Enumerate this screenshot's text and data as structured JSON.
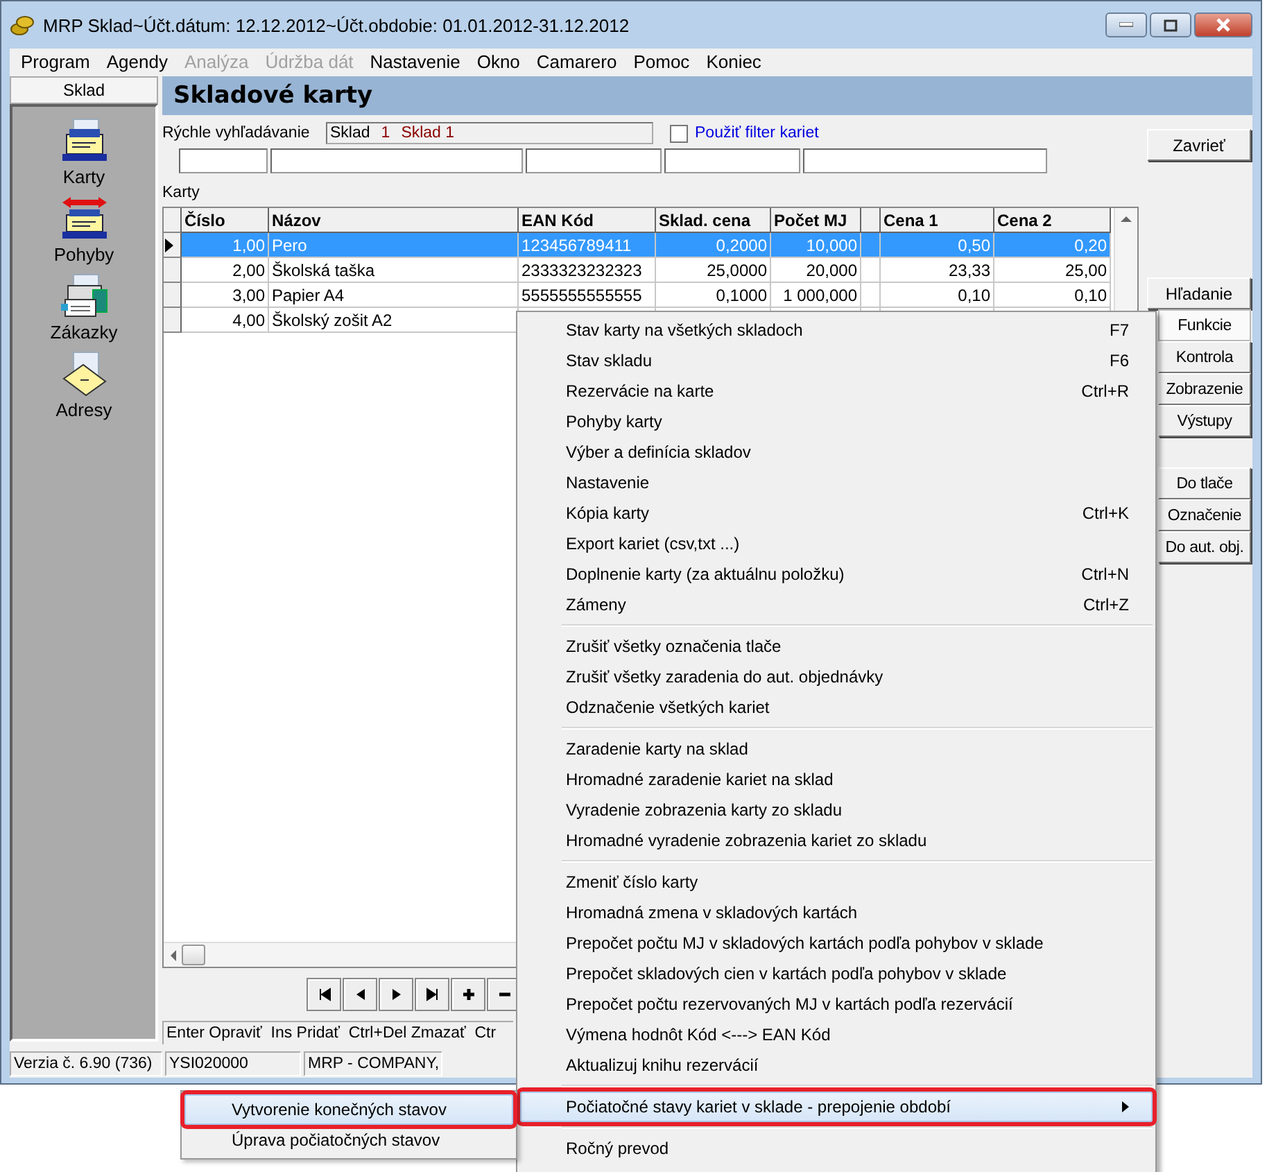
{
  "window": {
    "title": "MRP Sklad~Účt.dátum: 12.12.2012~Účt.obdobie: 01.01.2012-31.12.2012"
  },
  "menu_bar": [
    {
      "label": "Program",
      "disabled": false
    },
    {
      "label": "Agendy",
      "disabled": false
    },
    {
      "label": "Analýza",
      "disabled": true
    },
    {
      "label": "Údržba dát",
      "disabled": true
    },
    {
      "label": "Nastavenie",
      "disabled": false
    },
    {
      "label": "Okno",
      "disabled": false
    },
    {
      "label": "Camarero",
      "disabled": false
    },
    {
      "label": "Pomoc",
      "disabled": false
    },
    {
      "label": "Koniec",
      "disabled": false
    }
  ],
  "sidebar": {
    "title": "Sklad",
    "items": [
      {
        "label": "Karty",
        "kind": "cards"
      },
      {
        "label": "Pohyby",
        "kind": "movements"
      },
      {
        "label": "Zákazky",
        "kind": "orders"
      },
      {
        "label": "Adresy",
        "kind": "addresses"
      }
    ]
  },
  "header": "Skladové karty",
  "quick_search": {
    "label": "Rýchle vyhľadávanie",
    "warehouse_label": "Sklad",
    "warehouse_number": "1",
    "warehouse_name": "Sklad 1",
    "filter": {
      "label": "Použiť filter kariet",
      "checked": false
    }
  },
  "table": {
    "label": "Karty",
    "columns": [
      "Číslo",
      "Názov",
      "EAN Kód",
      "Sklad. cena",
      "Počet MJ",
      "Cena 1",
      "Cena 2"
    ],
    "rows": [
      {
        "selected": true,
        "cells": [
          "1,00",
          "Pero",
          "123456789411",
          "0,2000",
          "10,000",
          "0,50",
          "0,20"
        ]
      },
      {
        "selected": false,
        "cells": [
          "2,00",
          "Školská taška",
          "2333323232323",
          "25,0000",
          "20,000",
          "23,33",
          "25,00"
        ]
      },
      {
        "selected": false,
        "cells": [
          "3,00",
          "Papier A4",
          "5555555555555",
          "0,1000",
          "1 000,000",
          "0,10",
          "0,10"
        ]
      },
      {
        "selected": false,
        "cells": [
          "4,00",
          "Školský zošit A2"
        ]
      }
    ]
  },
  "hint_bar": "Enter Opraviť  Ins Pridať  Ctrl+Del Zmazať  Ctr",
  "right_buttons": {
    "close": "Zavrieť",
    "sections": [
      {
        "label": "Hľadanie",
        "selected": false
      },
      {
        "label": "Funkcie",
        "selected": true
      },
      {
        "label": "Kontrola",
        "selected": false
      },
      {
        "label": "Zobrazenie",
        "selected": false
      },
      {
        "label": "Výstupy",
        "selected": false
      }
    ],
    "actions": [
      "Do tlače",
      "Označenie",
      "Do aut. obj."
    ]
  },
  "status_bar": [
    "Verzia č. 6.90 (736)",
    "YSI020000",
    "MRP - COMPANY,"
  ],
  "context_menu": {
    "items": [
      {
        "kind": "item",
        "label": "Stav karty na všetkých skladoch",
        "shortcut": "F7",
        "selected": false,
        "outlined": false
      },
      {
        "kind": "item",
        "label": "Stav skladu",
        "shortcut": "F6",
        "selected": false,
        "outlined": false
      },
      {
        "kind": "item",
        "label": "Rezervácie na karte",
        "shortcut": "Ctrl+R",
        "selected": false,
        "outlined": false
      },
      {
        "kind": "item",
        "label": "Pohyby karty",
        "selected": false,
        "outlined": false
      },
      {
        "kind": "item",
        "label": "Výber a definícia skladov",
        "selected": false,
        "outlined": false
      },
      {
        "kind": "item",
        "label": "Nastavenie",
        "selected": false,
        "outlined": false
      },
      {
        "kind": "item",
        "label": "Kópia karty",
        "shortcut": "Ctrl+K",
        "selected": false,
        "outlined": false
      },
      {
        "kind": "item",
        "label": "Export kariet (csv,txt ...)",
        "selected": false,
        "outlined": false
      },
      {
        "kind": "item",
        "label": "Doplnenie karty (za aktuálnu položku)",
        "shortcut": "Ctrl+N",
        "selected": false,
        "outlined": false
      },
      {
        "kind": "item",
        "label": "Zámeny",
        "shortcut": "Ctrl+Z",
        "selected": false,
        "outlined": false
      },
      {
        "kind": "separator"
      },
      {
        "kind": "item",
        "label": "Zrušiť všetky označenia tlače",
        "selected": false,
        "outlined": false
      },
      {
        "kind": "item",
        "label": "Zrušiť všetky zaradenia do aut. objednávky",
        "selected": false,
        "outlined": false
      },
      {
        "kind": "item",
        "label": "Odznačenie všetkých kariet",
        "selected": false,
        "outlined": false
      },
      {
        "kind": "separator"
      },
      {
        "kind": "item",
        "label": "Zaradenie karty na sklad",
        "selected": false,
        "outlined": false
      },
      {
        "kind": "item",
        "label": "Hromadné zaradenie kariet na sklad",
        "selected": false,
        "outlined": false
      },
      {
        "kind": "item",
        "label": "Vyradenie zobrazenia karty zo skladu",
        "selected": false,
        "outlined": false
      },
      {
        "kind": "item",
        "label": "Hromadné vyradenie zobrazenia kariet zo skladu",
        "selected": false,
        "outlined": false
      },
      {
        "kind": "separator"
      },
      {
        "kind": "item",
        "label": "Zmeniť číslo karty",
        "selected": false,
        "outlined": false
      },
      {
        "kind": "item",
        "label": "Hromadná zmena v skladových kartách",
        "selected": false,
        "outlined": false
      },
      {
        "kind": "item",
        "label": "Prepočet počtu MJ v skladových kartách podľa pohybov v sklade",
        "selected": false,
        "outlined": false
      },
      {
        "kind": "item",
        "label": "Prepočet skladových cien v kartách podľa pohybov v sklade",
        "selected": false,
        "outlined": false
      },
      {
        "kind": "item",
        "label": "Prepočet počtu rezervovaných MJ v kartách podľa rezervácií",
        "selected": false,
        "outlined": false
      },
      {
        "kind": "item",
        "label": "Výmena hodnôt Kód <---> EAN Kód",
        "selected": false,
        "outlined": false
      },
      {
        "kind": "item",
        "label": "Aktualizuj knihu rezervácií",
        "selected": false,
        "outlined": false
      },
      {
        "kind": "separator"
      },
      {
        "kind": "submenu",
        "label": "Počiatočné stavy kariet v sklade - prepojenie období",
        "selected": true,
        "outlined": true
      },
      {
        "kind": "separator"
      },
      {
        "kind": "item",
        "label": "Ročný prevod",
        "selected": false,
        "outlined": false
      }
    ]
  },
  "submenu": {
    "items": [
      {
        "label": "Vytvorenie konečných stavov",
        "selected": true,
        "outlined": true
      },
      {
        "label": "Úprava počiatočných stavov",
        "selected": false,
        "outlined": false
      }
    ]
  }
}
